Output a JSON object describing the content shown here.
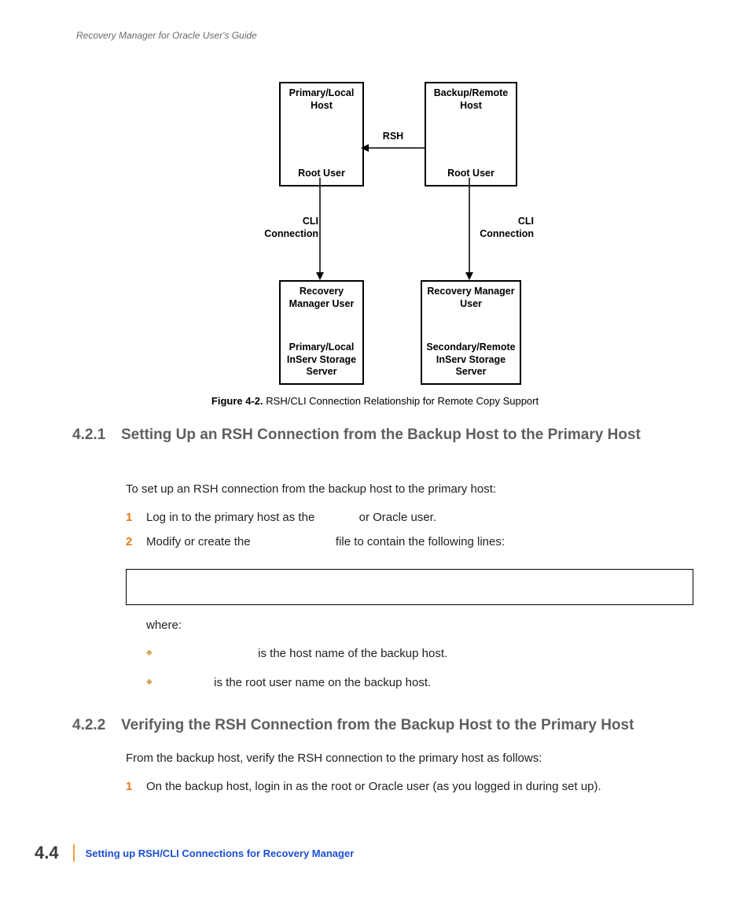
{
  "header": {
    "running": "Recovery Manager for Oracle User's Guide"
  },
  "diagram": {
    "box_top_left": {
      "top": "Primary/Local Host",
      "bottom": "Root User"
    },
    "box_top_right": {
      "top": "Backup/Remote Host",
      "bottom": "Root User"
    },
    "box_bot_left": {
      "top": "Recovery Manager User",
      "bottom": "Primary/Local InServ Storage Server"
    },
    "box_bot_right": {
      "top": "Recovery Manager User",
      "bottom": "Secondary/Remote InServ Storage Server"
    },
    "label_rsh": "RSH",
    "label_cli_left": "CLI Connection",
    "label_cli_right": "CLI Connection"
  },
  "figure": {
    "label": "Figure 4-2.",
    "caption": "RSH/CLI Connection Relationship for Remote Copy Support"
  },
  "section_421": {
    "num": "4.2.1",
    "title": "Setting Up an RSH Connection from the Backup Host to the Primary Host",
    "intro": "To set up an RSH connection from the backup host to the primary host:",
    "steps": {
      "n1": "1",
      "s1a": "Log in to the primary host as the ",
      "s1b": " or Oracle user.",
      "n2": "2",
      "s2a": "Modify or create the ",
      "s2b": " file to contain the following lines:"
    },
    "where": "where:",
    "bullets": {
      "b1": " is the host name of the backup host.",
      "b2": " is the root user name on the backup host."
    }
  },
  "section_422": {
    "num": "4.2.2",
    "title": "Verifying the RSH Connection from the Backup Host to the Primary Host",
    "intro": "From the backup host, verify the RSH connection to the primary host as follows:",
    "steps": {
      "n1": "1",
      "s1": "On the backup host, login in as the root or Oracle user (as you logged in during set up)."
    }
  },
  "footer": {
    "page": "4.4",
    "chapter": "Setting up RSH/CLI Connections for Recovery Manager"
  }
}
